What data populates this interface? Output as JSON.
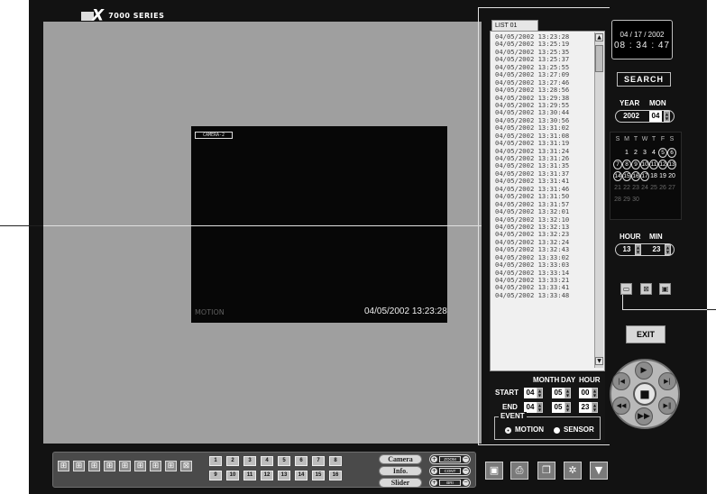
{
  "header": {
    "brand_mark": "X",
    "series": "7000 SERIES"
  },
  "video": {
    "camera_label": "CAMERA-2",
    "mode": "MOTION",
    "timestamp": "04/05/2002 13:23:28"
  },
  "list": {
    "tab": "LIST 01",
    "entries": [
      "04/05/2002 13:23:28",
      "04/05/2002 13:25:19",
      "04/05/2002 13:25:35",
      "04/05/2002 13:25:37",
      "04/05/2002 13:25:55",
      "04/05/2002 13:27:09",
      "04/05/2002 13:27:46",
      "04/05/2002 13:28:56",
      "04/05/2002 13:29:38",
      "04/05/2002 13:29:55",
      "04/05/2002 13:30:44",
      "04/05/2002 13:30:56",
      "04/05/2002 13:31:02",
      "04/05/2002 13:31:08",
      "04/05/2002 13:31:19",
      "04/05/2002 13:31:24",
      "04/05/2002 13:31:26",
      "04/05/2002 13:31:35",
      "04/05/2002 13:31:37",
      "04/05/2002 13:31:41",
      "04/05/2002 13:31:46",
      "04/05/2002 13:31:50",
      "04/05/2002 13:31:57",
      "04/05/2002 13:32:01",
      "04/05/2002 13:32:10",
      "04/05/2002 13:32:13",
      "04/05/2002 13:32:23",
      "04/05/2002 13:32:24",
      "04/05/2002 13:32:43",
      "04/05/2002 13:33:02",
      "04/05/2002 13:33:03",
      "04/05/2002 13:33:14",
      "04/05/2002 13:33:21",
      "04/05/2002 13:33:41",
      "04/05/2002 13:33:48"
    ]
  },
  "range": {
    "headers": {
      "month": "MONTH",
      "day": "DAY",
      "hour": "HOUR"
    },
    "start": {
      "label": "START",
      "month": "04",
      "day": "05",
      "hour": "00"
    },
    "end": {
      "label": "END",
      "month": "04",
      "day": "05",
      "hour": "23"
    },
    "event": {
      "legend": "EVENT",
      "motion": "MOTION",
      "sensor": "SENSOR",
      "selected": "motion"
    }
  },
  "clock": {
    "date": "04 / 17 / 2002",
    "time": "08 : 34 : 47"
  },
  "search": {
    "label": "SEARCH"
  },
  "year_month": {
    "year_label": "YEAR",
    "month_label": "MON",
    "year": "2002",
    "month": "04"
  },
  "calendar": {
    "weekdays": [
      "S",
      "M",
      "T",
      "W",
      "T",
      "F",
      "S"
    ],
    "weeks": [
      [
        "",
        "1",
        "2",
        "3",
        "4",
        "5",
        "6"
      ],
      [
        "7",
        "8",
        "9",
        "10",
        "11",
        "12",
        "13"
      ],
      [
        "14",
        "15",
        "16",
        "17",
        "18",
        "19",
        "20"
      ],
      [
        "21",
        "22",
        "23",
        "24",
        "25",
        "26",
        "27"
      ],
      [
        "28",
        "29",
        "30",
        "",
        "",
        "",
        ""
      ]
    ],
    "event_days": [
      "5",
      "6",
      "7",
      "8",
      "9",
      "10",
      "11",
      "12",
      "13",
      "14",
      "15",
      "16",
      "17"
    ]
  },
  "hour_min": {
    "hour_label": "HOUR",
    "min_label": "MIN",
    "hour": "13",
    "min": "23"
  },
  "exit": {
    "label": "EXIT"
  },
  "bottom": {
    "channels": [
      "1",
      "2",
      "3",
      "4",
      "5",
      "6",
      "7",
      "8",
      "9",
      "10",
      "11",
      "12",
      "13",
      "14",
      "15",
      "16"
    ],
    "pill_buttons": [
      "Camera",
      "Info.",
      "Slider"
    ],
    "controls": [
      "ZOOM",
      "CONT",
      "BRI"
    ]
  }
}
